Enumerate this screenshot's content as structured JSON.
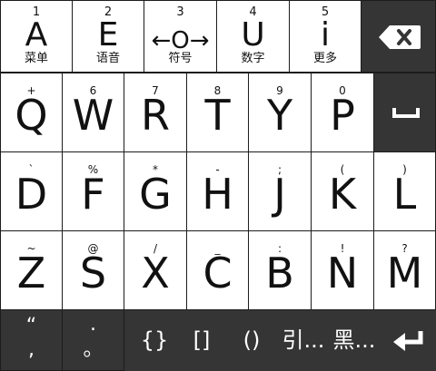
{
  "top_row": [
    {
      "num": "1",
      "big": "A",
      "cn": "菜单"
    },
    {
      "num": "2",
      "big": "E",
      "cn": "语音"
    },
    {
      "num": "3",
      "big": "←O→",
      "cn": "符号"
    },
    {
      "num": "4",
      "big": "U",
      "cn": "数字"
    },
    {
      "num": "5",
      "big": "i",
      "cn": "更多"
    }
  ],
  "row_qwert": [
    {
      "sym": "+",
      "letter": "Q"
    },
    {
      "sym": "6",
      "letter": "W"
    },
    {
      "sym": "7",
      "letter": "R"
    },
    {
      "sym": "8",
      "letter": "T"
    },
    {
      "sym": "9",
      "letter": "Y"
    },
    {
      "sym": "0",
      "letter": "P"
    }
  ],
  "row_dfg": [
    {
      "sym": "`",
      "letter": "D"
    },
    {
      "sym": "%",
      "letter": "F"
    },
    {
      "sym": "*",
      "letter": "G"
    },
    {
      "sym": "-",
      "letter": "H"
    },
    {
      "sym": ";",
      "letter": "J"
    },
    {
      "sym": "(",
      "letter": "K"
    },
    {
      "sym": ")",
      "letter": "L"
    }
  ],
  "row_zsx": [
    {
      "sym": "~",
      "letter": "Z"
    },
    {
      "sym": "@",
      "letter": "S"
    },
    {
      "sym": "/",
      "letter": "X"
    },
    {
      "sym": "_",
      "letter": "C"
    },
    {
      "sym": ":",
      "letter": "B"
    },
    {
      "sym": "!",
      "letter": "N"
    },
    {
      "sym": "?",
      "letter": "M"
    }
  ],
  "punct1": {
    "top": "“",
    "bottom": ","
  },
  "punct2": {
    "top": ".",
    "bottom": "。"
  },
  "candidates": [
    "{}",
    "[]",
    "()",
    "引...",
    "黑..."
  ],
  "icons": {
    "backspace": "backspace-icon",
    "space": "space-icon",
    "enter": "enter-icon"
  },
  "colors": {
    "key_bg": "#ffffff",
    "dark_bg": "#353535",
    "separator": "#1c1c1c"
  }
}
